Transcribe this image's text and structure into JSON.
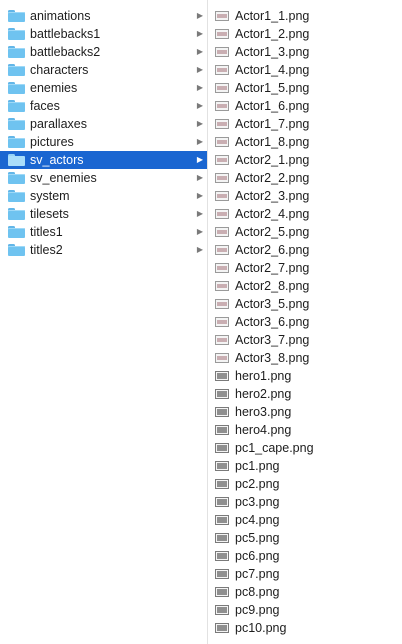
{
  "folders": [
    {
      "label": "animations",
      "selected": false
    },
    {
      "label": "battlebacks1",
      "selected": false
    },
    {
      "label": "battlebacks2",
      "selected": false
    },
    {
      "label": "characters",
      "selected": false
    },
    {
      "label": "enemies",
      "selected": false
    },
    {
      "label": "faces",
      "selected": false
    },
    {
      "label": "parallaxes",
      "selected": false
    },
    {
      "label": "pictures",
      "selected": false
    },
    {
      "label": "sv_actors",
      "selected": true
    },
    {
      "label": "sv_enemies",
      "selected": false
    },
    {
      "label": "system",
      "selected": false
    },
    {
      "label": "tilesets",
      "selected": false
    },
    {
      "label": "titles1",
      "selected": false
    },
    {
      "label": "titles2",
      "selected": false
    }
  ],
  "files": [
    {
      "label": "Actor1_1.png",
      "icon": "image-file-icon"
    },
    {
      "label": "Actor1_2.png",
      "icon": "image-file-icon"
    },
    {
      "label": "Actor1_3.png",
      "icon": "image-file-icon"
    },
    {
      "label": "Actor1_4.png",
      "icon": "image-file-icon"
    },
    {
      "label": "Actor1_5.png",
      "icon": "image-file-icon"
    },
    {
      "label": "Actor1_6.png",
      "icon": "image-file-icon"
    },
    {
      "label": "Actor1_7.png",
      "icon": "image-file-icon"
    },
    {
      "label": "Actor1_8.png",
      "icon": "image-file-icon"
    },
    {
      "label": "Actor2_1.png",
      "icon": "image-file-icon"
    },
    {
      "label": "Actor2_2.png",
      "icon": "image-file-icon"
    },
    {
      "label": "Actor2_3.png",
      "icon": "image-file-icon"
    },
    {
      "label": "Actor2_4.png",
      "icon": "image-file-icon"
    },
    {
      "label": "Actor2_5.png",
      "icon": "image-file-icon"
    },
    {
      "label": "Actor2_6.png",
      "icon": "image-file-icon"
    },
    {
      "label": "Actor2_7.png",
      "icon": "image-file-icon"
    },
    {
      "label": "Actor2_8.png",
      "icon": "image-file-icon"
    },
    {
      "label": "Actor3_5.png",
      "icon": "image-file-icon"
    },
    {
      "label": "Actor3_6.png",
      "icon": "image-file-icon"
    },
    {
      "label": "Actor3_7.png",
      "icon": "image-file-icon"
    },
    {
      "label": "Actor3_8.png",
      "icon": "image-file-icon"
    },
    {
      "label": "hero1.png",
      "icon": "image-file-dark-icon"
    },
    {
      "label": "hero2.png",
      "icon": "image-file-dark-icon"
    },
    {
      "label": "hero3.png",
      "icon": "image-file-dark-icon"
    },
    {
      "label": "hero4.png",
      "icon": "image-file-dark-icon"
    },
    {
      "label": "pc1_cape.png",
      "icon": "image-file-dark-icon"
    },
    {
      "label": "pc1.png",
      "icon": "image-file-dark-icon"
    },
    {
      "label": "pc2.png",
      "icon": "image-file-dark-icon"
    },
    {
      "label": "pc3.png",
      "icon": "image-file-dark-icon"
    },
    {
      "label": "pc4.png",
      "icon": "image-file-dark-icon"
    },
    {
      "label": "pc5.png",
      "icon": "image-file-dark-icon"
    },
    {
      "label": "pc6.png",
      "icon": "image-file-dark-icon"
    },
    {
      "label": "pc7.png",
      "icon": "image-file-dark-icon"
    },
    {
      "label": "pc8.png",
      "icon": "image-file-dark-icon"
    },
    {
      "label": "pc9.png",
      "icon": "image-file-dark-icon"
    },
    {
      "label": "pc10.png",
      "icon": "image-file-dark-icon"
    }
  ],
  "colors": {
    "selection": "#1a66d1",
    "folder": "#6fc3f0",
    "chevron": "#7a7a7a"
  },
  "icons": {
    "folder": "folder-icon",
    "chevron": "chevron-right-icon",
    "chevron_glyph": "▶"
  }
}
